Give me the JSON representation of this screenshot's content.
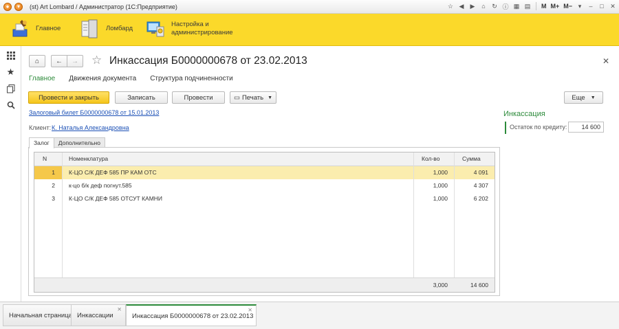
{
  "window": {
    "title": "(st) Art Lombard / Администратор  (1С:Предприятие)",
    "controls": {
      "m": "M",
      "mplus": "M+",
      "mminus": "M−"
    }
  },
  "sections": [
    {
      "label_line1": "Главное",
      "label_line2": ""
    },
    {
      "label_line1": "Ломбард",
      "label_line2": ""
    },
    {
      "label_line1": "Настройка и",
      "label_line2": "администрирование"
    }
  ],
  "form": {
    "title": "Инкассация Б0000000678 от 23.02.2013",
    "nav_tabs": [
      {
        "label": "Главное"
      },
      {
        "label": "Движения документа"
      },
      {
        "label": "Структура подчиненности"
      }
    ],
    "buttons": {
      "post_close": "Провести и закрыть",
      "save": "Записать",
      "post": "Провести",
      "print": "Печать",
      "more": "Еще"
    },
    "pledge_ticket_link": "Залоговый билет Б0000000678 от 15.01.2013",
    "client_label": "Клиент:",
    "client_name": "К. Наталья Александровна",
    "tabs": [
      {
        "label": "Залог"
      },
      {
        "label": "Дополнительно"
      }
    ],
    "table": {
      "headers": {
        "n": "N",
        "item": "Номенклатура",
        "qty": "Кол-во",
        "sum": "Сумма"
      },
      "rows": [
        {
          "n": "1",
          "item": "К-ЦО С/К ДЕФ 585 ПР КАМ ОТС",
          "qty": "1,000",
          "sum": "4 091"
        },
        {
          "n": "2",
          "item": "к-цо б/к деф погнут.585",
          "qty": "1,000",
          "sum": "4 307"
        },
        {
          "n": "3",
          "item": "К-ЦО С/К ДЕФ 585 ОТСУТ КАМНИ",
          "qty": "1,000",
          "sum": "6 202"
        }
      ],
      "footer": {
        "qty": "3,000",
        "sum": "14 600"
      }
    },
    "right_panel": {
      "title": "Инкассация",
      "balance_label": "Остаток по кредиту:",
      "balance_value": "14 600"
    }
  },
  "bottom_tabs": [
    {
      "label": "Начальная страница"
    },
    {
      "label": "Инкассации"
    },
    {
      "label": "Инкассация Б0000000678 от 23.02.2013"
    }
  ],
  "colors": {
    "sections_bg": "#fbd92a",
    "accent_green": "#2c8a3a",
    "primary_button": "#f5c51b",
    "selected_row": "#fbedae",
    "link": "#1a4fb5"
  }
}
